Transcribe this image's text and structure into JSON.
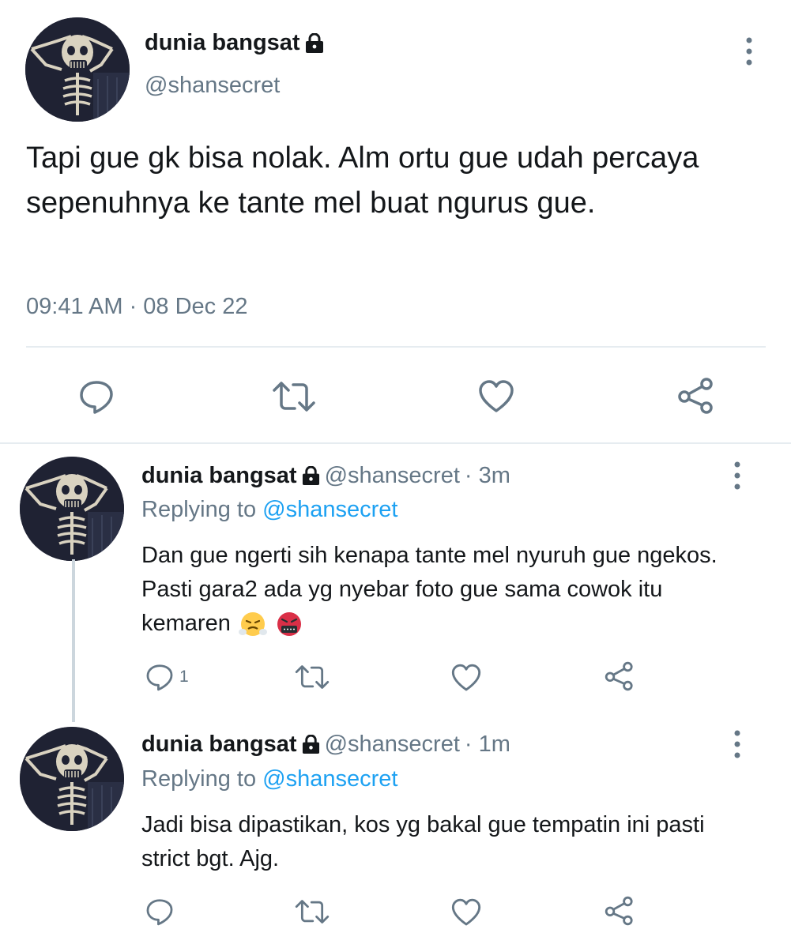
{
  "main_tweet": {
    "name": "dunia bangsat",
    "handle": "@shansecret",
    "text": "Tapi gue gk bisa nolak. Alm ortu gue udah percaya sepenuhnya ke tante mel buat ngurus gue.",
    "timestamp": "09:41 AM · 08 Dec 22",
    "icons": [
      "lock-icon",
      "more-vertical-icon",
      "reply-icon",
      "retweet-icon",
      "like-icon",
      "share-icon"
    ]
  },
  "replies": [
    {
      "name": "dunia bangsat",
      "handle": "@shansecret",
      "time": "· 3m",
      "replying_prefix": "Replying to",
      "replying_to": "@shansecret",
      "text": "Dan gue ngerti sih kenapa tante mel nyuruh gue ngekos. Pasti gara2 ada yg nyebar foto gue sama cowok itu kemaren",
      "emojis": [
        "steam-from-nose-emoji",
        "face-with-symbols-emoji"
      ],
      "reply_count": "1"
    },
    {
      "name": "dunia bangsat",
      "handle": "@shansecret",
      "time": "· 1m",
      "replying_prefix": "Replying to",
      "replying_to": "@shansecret",
      "text": "Jadi bisa dipastikan, kos yg bakal gue tempatin ini pasti strict bgt. Ajg.",
      "reply_count": ""
    }
  ],
  "colors": {
    "text": "#14171a",
    "secondary": "#657786",
    "link": "#1da1f2",
    "divider": "#e6ecf0",
    "thread_line": "#ccd6dd"
  }
}
